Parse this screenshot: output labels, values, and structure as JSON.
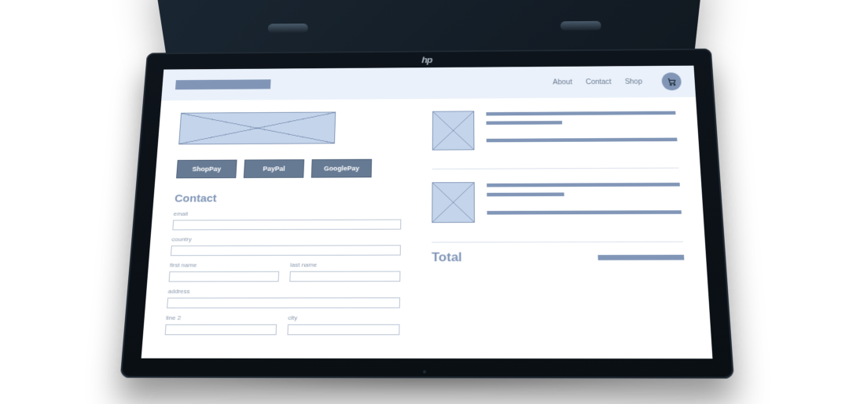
{
  "device": {
    "brand_logo": "hp"
  },
  "header": {
    "nav": {
      "about": "About",
      "contact": "Contact",
      "shop": "Shop"
    },
    "cart_icon": "cart-icon"
  },
  "checkout": {
    "payments": {
      "shoppay": "ShopPay",
      "paypal": "PayPal",
      "googlepay": "GooglePay"
    },
    "contact_heading": "Contact",
    "fields": {
      "email_label": "email",
      "country_label": "country",
      "first_name_label": "first name",
      "last_name_label": "last name",
      "address_label": "address",
      "line2_label": "line 2",
      "city_label": "city"
    }
  },
  "summary": {
    "total_label": "Total"
  }
}
